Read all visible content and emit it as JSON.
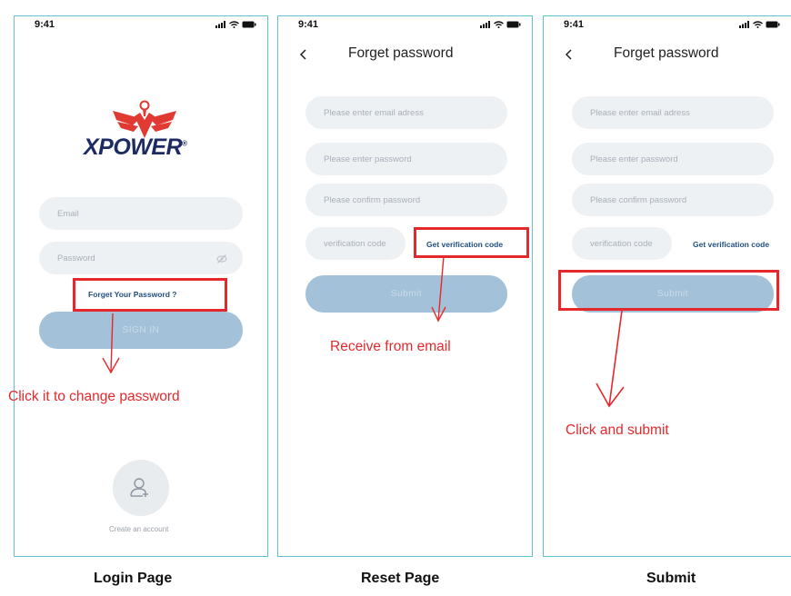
{
  "status_bar": {
    "time": "9:41"
  },
  "login": {
    "logo_text": "XPOWER",
    "logo_registered": "®",
    "email_placeholder": "Email",
    "password_placeholder": "Password",
    "forgot_link": "Forget Your Password ?",
    "signin_label": "SIGN IN",
    "create_account": "Create an account"
  },
  "reset": {
    "title": "Forget password",
    "email_placeholder": "Please enter email adress",
    "password_placeholder": "Please enter password",
    "confirm_placeholder": "Please confirm password",
    "code_placeholder": "verification code",
    "get_code_link": "Get verification code",
    "submit_label": "Submit"
  },
  "submit": {
    "title": "Forget password",
    "email_placeholder": "Please enter email adress",
    "password_placeholder": "Please enter password",
    "confirm_placeholder": "Please confirm password",
    "code_placeholder": "verification code",
    "get_code_link": "Get verification code",
    "submit_label": "Submit"
  },
  "annotations": {
    "login_note": "Click it to change password",
    "reset_note": "Receive from email",
    "submit_note": "Click and submit"
  },
  "captions": {
    "login": "Login Page",
    "reset": "Reset Page",
    "submit": "Submit"
  },
  "colors": {
    "annotation_red": "#e5282c",
    "frame_border": "#5fc4cf",
    "button_fill": "#a3c2d9",
    "field_fill": "#eef1f4",
    "link_blue": "#1f4f7f",
    "logo_red": "#e03a32",
    "logo_navy": "#1d2b63"
  }
}
